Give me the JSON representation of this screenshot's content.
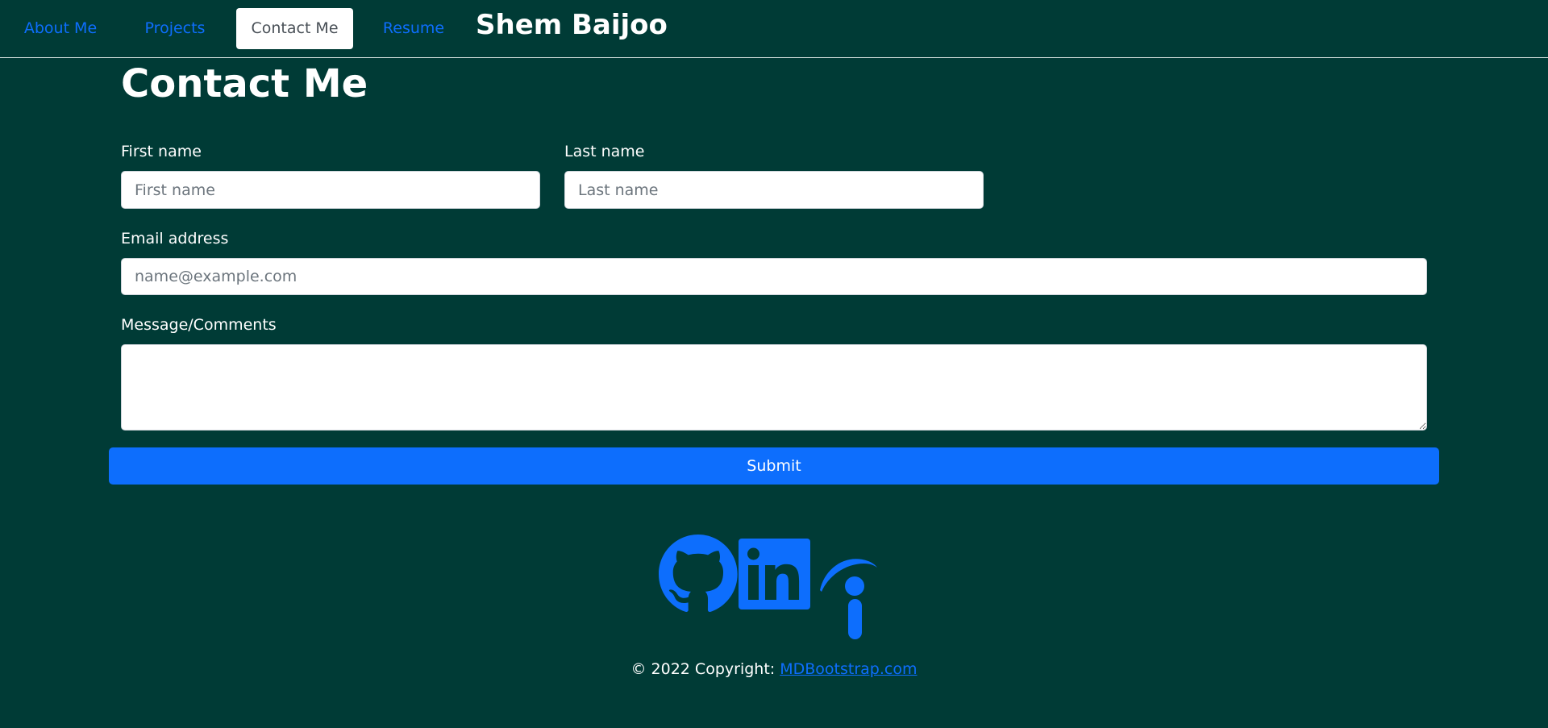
{
  "nav": {
    "items": [
      {
        "label": "About Me",
        "active": false
      },
      {
        "label": "Projects",
        "active": false
      },
      {
        "label": "Contact Me",
        "active": true
      },
      {
        "label": "Resume",
        "active": false
      }
    ],
    "brand": "Shem Baijoo"
  },
  "page": {
    "title": "Contact Me"
  },
  "form": {
    "first_name": {
      "label": "First name",
      "placeholder": "First name",
      "value": ""
    },
    "last_name": {
      "label": "Last name",
      "placeholder": "Last name",
      "value": ""
    },
    "email": {
      "label": "Email address",
      "placeholder": "name@example.com",
      "value": ""
    },
    "message": {
      "label": "Message/Comments",
      "value": ""
    },
    "submit_label": "Submit"
  },
  "social": {
    "icons": [
      "github-icon",
      "linkedin-icon",
      "indeed-icon"
    ]
  },
  "footer": {
    "copyright_text": "© 2022 Copyright:",
    "link_text": "MDBootstrap.com"
  },
  "colors": {
    "background": "#003b36",
    "accent": "#0d6efd",
    "text": "#ffffff"
  }
}
